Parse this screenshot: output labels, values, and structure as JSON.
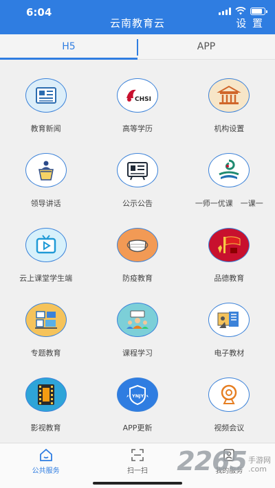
{
  "status_bar": {
    "time": "6:04"
  },
  "header": {
    "title": "云南教育云",
    "settings_label": "设 置"
  },
  "tabs": [
    {
      "label": "H5",
      "active": true
    },
    {
      "label": "APP",
      "active": false
    }
  ],
  "grid_items": [
    {
      "label": "教育新闻",
      "icon": "newspaper-icon"
    },
    {
      "label": "高等学历",
      "icon": "chsi-logo-icon",
      "logo_text": "CHSI"
    },
    {
      "label": "机构设置",
      "icon": "institution-building-icon"
    },
    {
      "label": "领导讲话",
      "icon": "podium-speaker-icon"
    },
    {
      "label": "公示公告",
      "icon": "notice-board-icon"
    },
    {
      "label": "一师一优课　一课一",
      "icon": "lesson-logo-icon"
    },
    {
      "label": "云上课堂学生端",
      "icon": "tv-play-icon"
    },
    {
      "label": "防疫教育",
      "icon": "face-mask-icon"
    },
    {
      "label": "品德教育",
      "icon": "flag-icon"
    },
    {
      "label": "专题教育",
      "icon": "classroom-icon"
    },
    {
      "label": "课程学习",
      "icon": "students-learning-icon"
    },
    {
      "label": "电子教材",
      "icon": "e-textbook-icon"
    },
    {
      "label": "影视教育",
      "icon": "film-strip-icon"
    },
    {
      "label": "APP更新",
      "icon": "app-update-shield-icon",
      "logo_text": "YNJY"
    },
    {
      "label": "视频会议",
      "icon": "webcam-icon"
    }
  ],
  "bottom_nav": [
    {
      "label": "公共服务",
      "icon": "home-icon",
      "active": true
    },
    {
      "label": "扫一扫",
      "icon": "scan-icon",
      "active": false
    },
    {
      "label": "我的服务",
      "icon": "user-icon",
      "active": false
    }
  ],
  "watermark": {
    "number": "2265",
    "text": "手游网",
    "url": ".com"
  },
  "colors": {
    "primary": "#2f7de1",
    "icon_border": "#3b82d9",
    "background": "#f0f0f0"
  }
}
